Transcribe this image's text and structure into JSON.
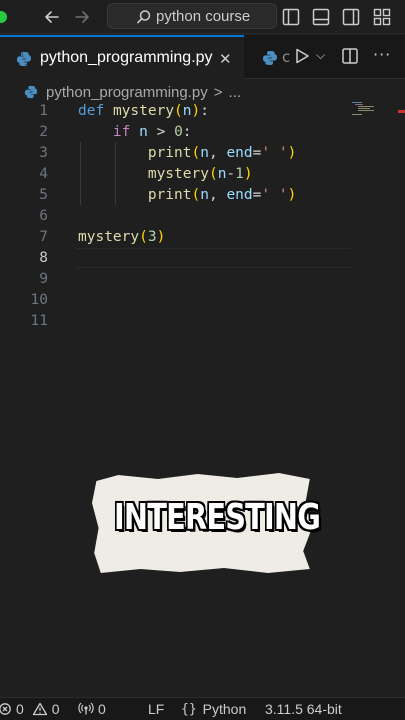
{
  "titlebar": {
    "search_text": "python course"
  },
  "tabs": {
    "active_label": "python_programming.py",
    "close_glyph": "✕",
    "second_label": "c"
  },
  "breadcrumb": {
    "file": "python_programming.py",
    "separator": ">",
    "ellipsis": "..."
  },
  "editor": {
    "line_numbers": [
      "1",
      "2",
      "3",
      "4",
      "5",
      "6",
      "7",
      "8",
      "9",
      "10",
      "11"
    ],
    "active_line": 8,
    "lines": [
      [
        {
          "t": "def",
          "c": "kw"
        },
        {
          "t": " ",
          "c": "plain"
        },
        {
          "t": "mystery",
          "c": "fn"
        },
        {
          "t": "(",
          "c": "paren"
        },
        {
          "t": "n",
          "c": "param"
        },
        {
          "t": ")",
          "c": "paren"
        },
        {
          "t": ":",
          "c": "plain"
        }
      ],
      [
        {
          "t": "    ",
          "c": "plain"
        },
        {
          "t": "if",
          "c": "ctrl"
        },
        {
          "t": " ",
          "c": "plain"
        },
        {
          "t": "n",
          "c": "param"
        },
        {
          "t": " > ",
          "c": "plain"
        },
        {
          "t": "0",
          "c": "num"
        },
        {
          "t": ":",
          "c": "plain"
        }
      ],
      [
        {
          "t": "        ",
          "c": "plain"
        },
        {
          "t": "print",
          "c": "fn"
        },
        {
          "t": "(",
          "c": "paren"
        },
        {
          "t": "n",
          "c": "param"
        },
        {
          "t": ", ",
          "c": "plain"
        },
        {
          "t": "end",
          "c": "param"
        },
        {
          "t": "=",
          "c": "plain"
        },
        {
          "t": "' '",
          "c": "str"
        },
        {
          "t": ")",
          "c": "paren"
        }
      ],
      [
        {
          "t": "        ",
          "c": "plain"
        },
        {
          "t": "mystery",
          "c": "fn"
        },
        {
          "t": "(",
          "c": "paren"
        },
        {
          "t": "n",
          "c": "param"
        },
        {
          "t": "-",
          "c": "plain"
        },
        {
          "t": "1",
          "c": "num"
        },
        {
          "t": ")",
          "c": "paren"
        }
      ],
      [
        {
          "t": "        ",
          "c": "plain"
        },
        {
          "t": "print",
          "c": "fn"
        },
        {
          "t": "(",
          "c": "paren"
        },
        {
          "t": "n",
          "c": "param"
        },
        {
          "t": ", ",
          "c": "plain"
        },
        {
          "t": "end",
          "c": "param"
        },
        {
          "t": "=",
          "c": "plain"
        },
        {
          "t": "' '",
          "c": "str"
        },
        {
          "t": ")",
          "c": "paren"
        }
      ],
      [],
      [
        {
          "t": "mystery",
          "c": "fn"
        },
        {
          "t": "(",
          "c": "paren"
        },
        {
          "t": "3",
          "c": "num"
        },
        {
          "t": ")",
          "c": "paren"
        }
      ],
      [],
      [],
      [],
      []
    ]
  },
  "overlay": {
    "text": "INTERESTING"
  },
  "statusbar": {
    "errors": "0",
    "warnings": "0",
    "ports": "0",
    "eol": "LF",
    "language": "Python",
    "interpreter": "3.11.5 64-bit"
  },
  "colors": {
    "accent": "#0078d4",
    "background": "#1f1f1f",
    "keyword": "#569cd6",
    "function": "#dcdcaa",
    "string": "#ce9178"
  }
}
